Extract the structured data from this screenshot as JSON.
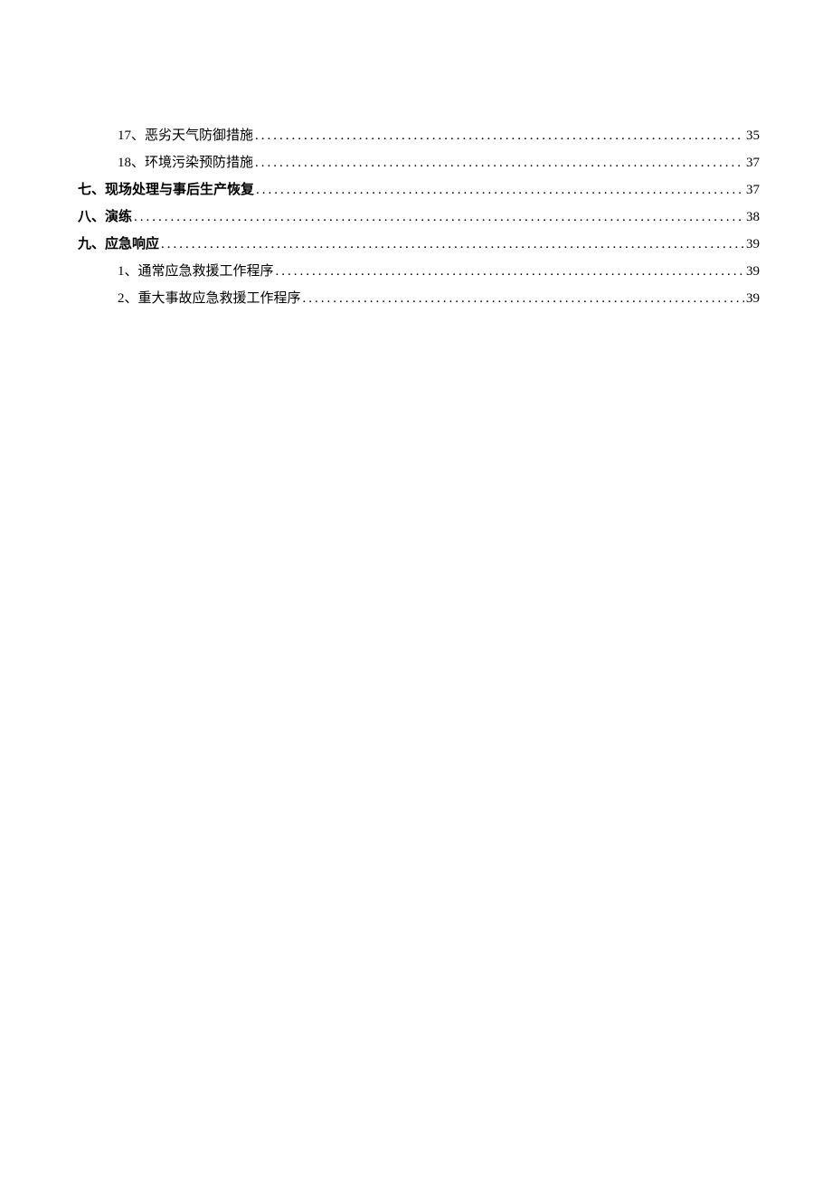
{
  "toc": [
    {
      "level": 2,
      "title": "17、恶劣天气防御措施",
      "page": "35"
    },
    {
      "level": 2,
      "title": "18、环境污染预防措施",
      "page": "37"
    },
    {
      "level": 1,
      "title": "七、现场处理与事后生产恢复",
      "page": "37"
    },
    {
      "level": 1,
      "title": "八、演练",
      "page": "38"
    },
    {
      "level": 1,
      "title": "九、应急响应",
      "page": "39"
    },
    {
      "level": 2,
      "title": "1、通常应急救援工作程序",
      "page": "39"
    },
    {
      "level": 2,
      "title": "2、重大事故应急救援工作程序",
      "page": "39"
    }
  ]
}
